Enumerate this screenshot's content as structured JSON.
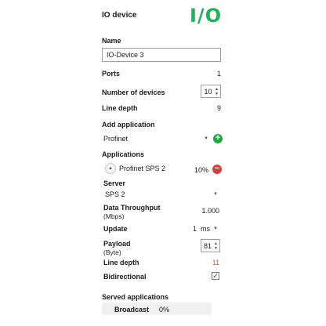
{
  "header": {
    "title": "IO device",
    "logo": "I/O",
    "logo_color": "#1fb35c"
  },
  "name": {
    "label": "Name",
    "value": "IO-Device 3"
  },
  "ports": {
    "label": "Ports",
    "value": "1"
  },
  "number_of_devices": {
    "label": "Number of devices",
    "value": "10"
  },
  "line_depth_top": {
    "label": "Line depth",
    "value": "9"
  },
  "add_application": {
    "label": "Add application",
    "selected": "Profinet",
    "add_icon": "plus-circle-icon"
  },
  "applications": {
    "label": "Applications",
    "item": {
      "name": "Profinet SPS 2",
      "percent": "10%",
      "remove_icon": "minus-circle-icon",
      "expand_icon": "chevron-up-icon"
    },
    "server": {
      "label": "Server",
      "selected": "SPS 2"
    },
    "data_throughput": {
      "label": "Data Throughput",
      "unit": "(Mbps)",
      "value": "1.000"
    },
    "update": {
      "label": "Update",
      "value": "1",
      "unit": "ms"
    },
    "payload": {
      "label": "Payload",
      "unit": "(Byte)",
      "value": "81"
    },
    "line_depth": {
      "label": "Line depth",
      "value": "11",
      "value_color": "#e2541f"
    },
    "bidirectional": {
      "label": "Bidirectional",
      "checked": true,
      "check_mark": "✓"
    }
  },
  "served_applications": {
    "label": "Served applications",
    "rows": [
      {
        "name": "Broadcast",
        "percent": "0%"
      }
    ]
  },
  "glyphs": {
    "caret_down": "▼",
    "arrow_up": "▲",
    "arrow_down": "▼",
    "plus": "+",
    "minus": "−"
  }
}
